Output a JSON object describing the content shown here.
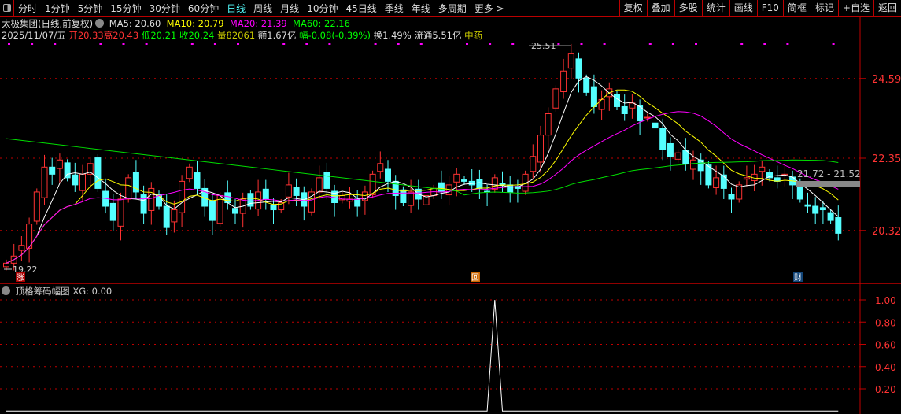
{
  "topbar": {
    "periods": [
      "分时",
      "1分钟",
      "5分钟",
      "15分钟",
      "30分钟",
      "60分钟",
      "日线",
      "周线",
      "月线",
      "10分钟",
      "45日线",
      "季线",
      "年线",
      "多周期",
      "更多 >"
    ],
    "active_period": "日线",
    "buttons": [
      "复权",
      "叠加",
      "多股",
      "统计",
      "画线",
      "F10",
      "简框",
      "标记",
      "+自选",
      "返回"
    ]
  },
  "header": {
    "title": "太极集团(日线,前复权)",
    "ma5": "MA5: 20.60",
    "ma10": "MA10: 20.79",
    "ma20": "MA20: 21.39",
    "ma60": "MA60: 22.16",
    "date": "2025/11/07/五",
    "open": "开20.33",
    "high": "高20.43",
    "low": "低20.21",
    "close": "收20.24",
    "volume": "量82061",
    "amount": "额1.67亿",
    "change": "幅-0.08(-0.39%)",
    "turnover": "换1.49%",
    "float": "流通5.51亿",
    "industry": "中药"
  },
  "colors": {
    "up": "#ff3232",
    "down": "#54ffff",
    "ma5": "#ffffff",
    "ma10": "#ffff00",
    "ma20": "#ff00ff",
    "ma60": "#00dd00",
    "grid": "#c00000"
  },
  "chart_data": {
    "type": "candlestick",
    "y_ticks": [
      "24.59",
      "22.35",
      "20.32"
    ],
    "max_label": "25.51",
    "min_label": "19.22",
    "range_label": "21.72 - 21.52",
    "closes": [
      19.4,
      19.6,
      19.9,
      20.5,
      21.4,
      22.1,
      21.9,
      22.3,
      21.8,
      21.6,
      21.9,
      22.2,
      21.5,
      21.0,
      20.6,
      21.2,
      21.8,
      21.4,
      20.8,
      21.5,
      21.0,
      20.4,
      20.9,
      21.7,
      22.1,
      21.5,
      21.0,
      20.6,
      21.3,
      21.1,
      20.8,
      21.2,
      21.0,
      21.4,
      21.2,
      20.9,
      21.1,
      21.6,
      21.3,
      21.0,
      21.4,
      21.8,
      21.5,
      21.1,
      21.3,
      21.2,
      21.0,
      21.4,
      21.9,
      22.2,
      21.7,
      21.3,
      21.1,
      21.4,
      21.2,
      21.3,
      21.5,
      21.4,
      21.6,
      21.9,
      21.7,
      21.6,
      21.5,
      21.4,
      21.8,
      21.6,
      21.4,
      21.5,
      21.9,
      22.4,
      23.0,
      23.6,
      24.3,
      24.8,
      25.3,
      24.6,
      24.2,
      23.8,
      24.0,
      24.3,
      23.8,
      23.6,
      23.9,
      23.4,
      23.5,
      23.2,
      22.6,
      22.4,
      22.5,
      22.2,
      22.3,
      22.0,
      21.6,
      21.8,
      21.5,
      21.2,
      21.6,
      21.8,
      21.9,
      22.1,
      21.8,
      21.7,
      21.9,
      21.6,
      21.2,
      21.0,
      20.8,
      20.9,
      20.6,
      20.24
    ],
    "markers": [
      "涨",
      "回",
      "财"
    ],
    "sub": {
      "title": "顶格筹码幅图",
      "xg_label": "XG: 0.00",
      "y_ticks": [
        "1.00",
        "0.80",
        "0.60",
        "0.40",
        "0.20"
      ],
      "spike_index": 64
    }
  }
}
